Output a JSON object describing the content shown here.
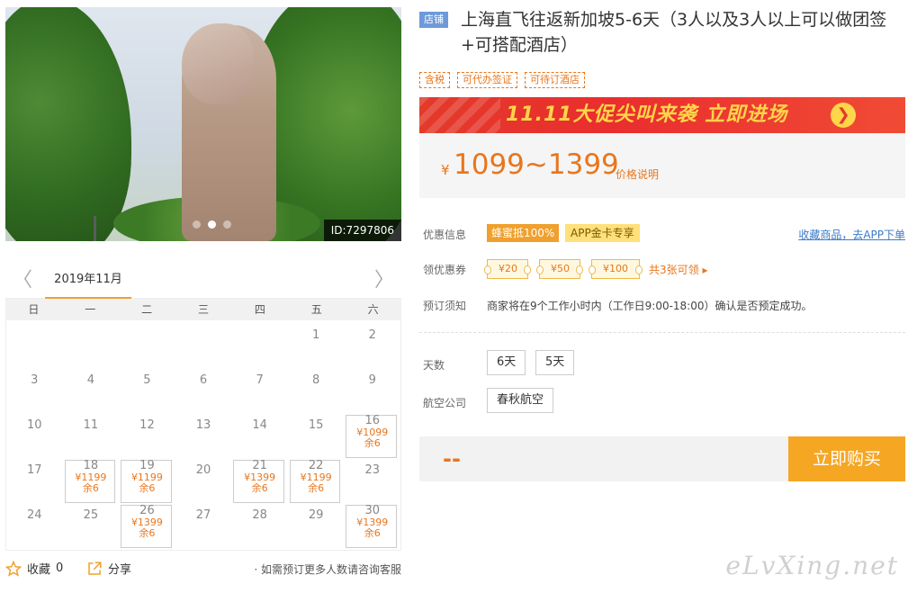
{
  "photo": {
    "id_tag": "ID:7297806",
    "slides": 3,
    "active_slide": 2
  },
  "calendar": {
    "prev": "〈",
    "next": "〉",
    "month": "2019年11月",
    "weekdays": [
      "日",
      "一",
      "二",
      "三",
      "四",
      "五",
      "六"
    ],
    "rows": [
      [
        {
          "d": ""
        },
        {
          "d": ""
        },
        {
          "d": ""
        },
        {
          "d": ""
        },
        {
          "d": ""
        },
        {
          "d": "1"
        },
        {
          "d": "2"
        }
      ],
      [
        {
          "d": "3"
        },
        {
          "d": "4"
        },
        {
          "d": "5"
        },
        {
          "d": "6"
        },
        {
          "d": "7"
        },
        {
          "d": "8"
        },
        {
          "d": "9"
        }
      ],
      [
        {
          "d": "10"
        },
        {
          "d": "11"
        },
        {
          "d": "12"
        },
        {
          "d": "13"
        },
        {
          "d": "14"
        },
        {
          "d": "15"
        },
        {
          "d": "16",
          "price": "¥1099",
          "stock": "余6"
        }
      ],
      [
        {
          "d": "17"
        },
        {
          "d": "18",
          "price": "¥1199",
          "stock": "余6"
        },
        {
          "d": "19",
          "price": "¥1199",
          "stock": "余6"
        },
        {
          "d": "20"
        },
        {
          "d": "21",
          "price": "¥1399",
          "stock": "余6"
        },
        {
          "d": "22",
          "price": "¥1199",
          "stock": "余6"
        },
        {
          "d": "23"
        }
      ],
      [
        {
          "d": "24"
        },
        {
          "d": "25"
        },
        {
          "d": "26",
          "price": "¥1399",
          "stock": "余6"
        },
        {
          "d": "27"
        },
        {
          "d": "28"
        },
        {
          "d": "29"
        },
        {
          "d": "30",
          "price": "¥1399",
          "stock": "余6"
        }
      ]
    ]
  },
  "footer": {
    "favorite_label": "收藏",
    "favorite_count": "0",
    "share_label": "分享",
    "consult": "· 如需预订更多人数请咨询客服"
  },
  "product": {
    "shop_badge": "店铺",
    "title": "上海直飞往返新加坡5-6天（3人以及3人以上可以做团签+可搭配酒店）",
    "tags": [
      "含税",
      "可代办签证",
      "可待订酒店"
    ],
    "promo_text": "11.11大促尖叫来袭 立即进场",
    "promo_go": "❯",
    "price_currency": "¥",
    "price_range": "1099~1399",
    "price_note": "价格说明"
  },
  "info": {
    "discount_label": "优惠信息",
    "discount_badge_1": "蜂蜜抵100%",
    "discount_badge_2": "APP金卡专享",
    "app_link": "收藏商品，去APP下单",
    "coupon_label": "领优惠券",
    "coupons": [
      "¥20",
      "¥50",
      "¥100"
    ],
    "coupon_more": "共3张可领 ▸",
    "booking_label": "预订须知",
    "booking_text": "商家将在9个工作小时内（工作日9:00-18:00）确认是否预定成功。"
  },
  "options": {
    "days_label": "天数",
    "days": [
      "6天",
      "5天"
    ],
    "airline_label": "航空公司",
    "airline": "春秋航空"
  },
  "buy": {
    "total": "--",
    "button": "立即购买"
  },
  "watermark": "eLvXing.net",
  "colors": {
    "accent": "#e8761d",
    "buy": "#f5a623",
    "promo": "#e33a2a",
    "link": "#3a7bc8"
  }
}
